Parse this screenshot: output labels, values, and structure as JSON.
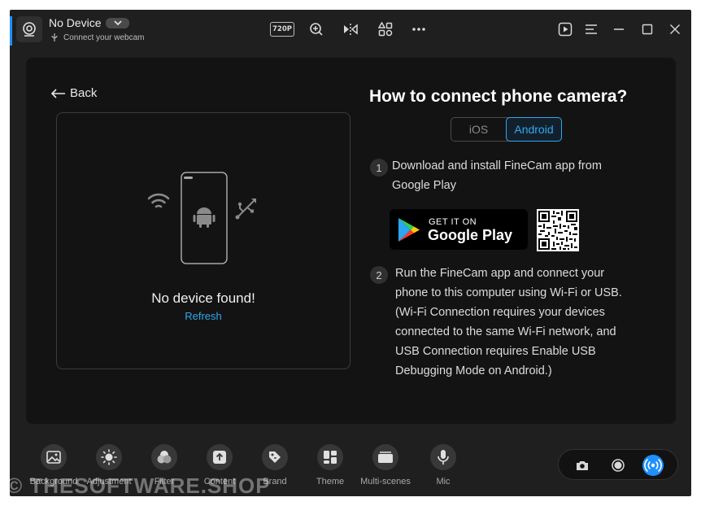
{
  "titlebar": {
    "device_name": "No Device",
    "device_sub": "Connect your webcam",
    "resolution": "720P",
    "icons": [
      "webcam-icon",
      "zoom-icon",
      "mirror-icon",
      "apps-icon",
      "more-icon",
      "play-icon",
      "menu-icon",
      "minimize-icon",
      "maximize-icon",
      "close-icon"
    ]
  },
  "left": {
    "back_label": "Back",
    "no_device": "No device found!",
    "refresh": "Refresh"
  },
  "right": {
    "title": "How to connect phone camera?",
    "tabs": [
      {
        "label": "iOS",
        "selected": false
      },
      {
        "label": "Android",
        "selected": true
      }
    ],
    "steps": [
      {
        "num": "1",
        "text": "Download and install FineCam app from Google Play"
      },
      {
        "num": "2",
        "text": "Run the FineCam app and connect your phone to this computer using Wi-Fi or USB. (Wi-Fi Connection requires your devices connected to the same Wi-Fi network, and USB Connection requires Enable USB Debugging Mode on Android.)"
      }
    ],
    "store": {
      "small": "GET IT ON",
      "big": "Google Play"
    }
  },
  "toolbar": {
    "items": [
      {
        "label": "Background",
        "icon": "image-icon"
      },
      {
        "label": "Adjustment",
        "icon": "sun-icon"
      },
      {
        "label": "Filter",
        "icon": "filter-icon"
      },
      {
        "label": "Content",
        "icon": "upload-icon"
      },
      {
        "label": "Brand",
        "icon": "tag-icon"
      },
      {
        "label": "Theme",
        "icon": "theme-icon"
      },
      {
        "label": "Multi-scenes",
        "icon": "scenes-icon"
      },
      {
        "label": "Mic",
        "icon": "mic-icon"
      }
    ]
  },
  "watermark": "© THESOFTWARE.SHOP",
  "colors": {
    "accent": "#2ea8f0",
    "window_bg": "#1f1f1f",
    "panel_bg": "#131313"
  }
}
